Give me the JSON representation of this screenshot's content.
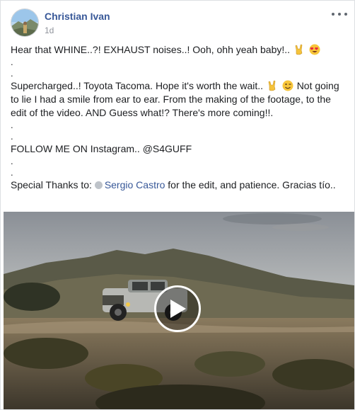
{
  "post": {
    "author": "Christian Ivan",
    "time": "1d",
    "lines": {
      "l1": "Hear that WHINE..?! EXHAUST noises..! Ooh, ohh yeah baby!..",
      "d1": ".",
      "d2": ".",
      "l2a": "Supercharged..! Toyota Tacoma. Hope it's worth the wait..",
      "l2b": "Not going",
      "l3": "to lie I had a smile from ear to ear. From the making of the footage, to the",
      "l4": "edit of the video. AND Guess what!? There's more coming!!.",
      "d3": ".",
      "d4": ".",
      "l5": "FOLLOW ME ON Instagram.. @S4GUFF",
      "d5": ".",
      "d6": ".",
      "l6a": "Special Thanks to:",
      "mention": "Sergio Castro",
      "l6b": "for the edit, and patience. Gracias tío.."
    },
    "emojis": {
      "rock_hand": "rock-on-emoji",
      "heart_eyes": "heart-eyes-emoji",
      "wink": "winking-face-emoji"
    }
  },
  "video": {
    "icon": "play-icon"
  },
  "colors": {
    "link": "#385898",
    "meta": "#90949c",
    "text": "#1c1e21"
  }
}
